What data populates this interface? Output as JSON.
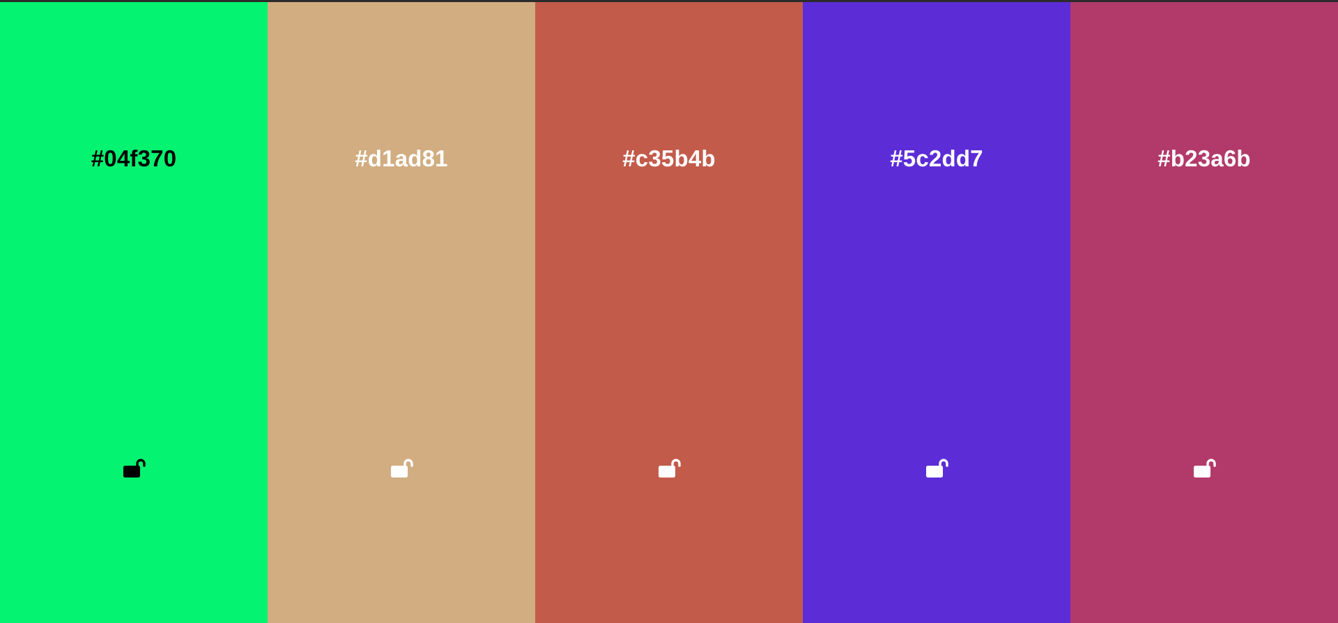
{
  "palette": {
    "colors": [
      {
        "hex": "#04f370",
        "text_color": "#000000",
        "lock_icon": "unlock-icon"
      },
      {
        "hex": "#d1ad81",
        "text_color": "#ffffff",
        "lock_icon": "unlock-icon"
      },
      {
        "hex": "#c35b4b",
        "text_color": "#ffffff",
        "lock_icon": "unlock-icon"
      },
      {
        "hex": "#5c2dd7",
        "text_color": "#ffffff",
        "lock_icon": "unlock-icon"
      },
      {
        "hex": "#b23a6b",
        "text_color": "#ffffff",
        "lock_icon": "unlock-icon"
      }
    ]
  }
}
